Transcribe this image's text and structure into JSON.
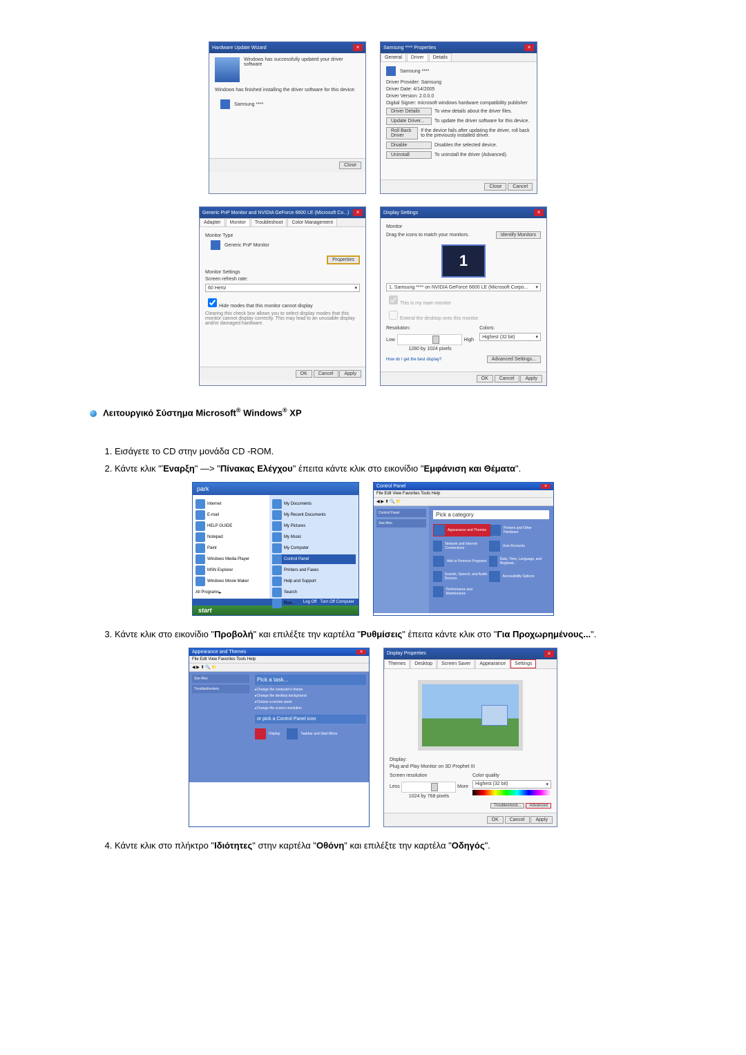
{
  "dialog1": {
    "title": "Hardware Update Wizard",
    "line1": "Windows has successfully updated your driver software",
    "line2": "Windows has finished installing the driver software for this device:",
    "device": "Samsung ****",
    "close_btn": "Close"
  },
  "dialog2": {
    "title": "Samsung **** Properties",
    "tabs": [
      "General",
      "Driver",
      "Details"
    ],
    "device": "Samsung ****",
    "provider_label": "Driver Provider:",
    "provider": "Samsung",
    "date_label": "Driver Date:",
    "date": "4/14/2005",
    "version_label": "Driver Version:",
    "version": "2.0.0.0",
    "signer_label": "Digital Signer:",
    "signer": "microsoft windows hardware compatibility publisher",
    "btn_details": "Driver Details",
    "btn_details_desc": "To view details about the driver files.",
    "btn_update": "Update Driver...",
    "btn_update_desc": "To update the driver software for this device.",
    "btn_rollback": "Roll Back Driver",
    "btn_rollback_desc": "If the device fails after updating the driver, roll back to the previously installed driver.",
    "btn_disable": "Disable",
    "btn_disable_desc": "Disables the selected device.",
    "btn_uninstall": "Uninstall",
    "btn_uninstall_desc": "To uninstall the driver (Advanced).",
    "close": "Close",
    "cancel": "Cancel"
  },
  "dialog3": {
    "title": "Generic PnP Monitor and NVIDIA GeForce 6600 LE (Microsoft Co...)",
    "tabs": [
      "Adapter",
      "Monitor",
      "Troubleshoot",
      "Color Management"
    ],
    "montype_label": "Monitor Type",
    "montype": "Generic PnP Monitor",
    "properties": "Properties",
    "settings_label": "Monitor Settings",
    "refresh_label": "Screen refresh rate:",
    "refresh_value": "60 Hertz",
    "hide_modes": "Hide modes that this monitor cannot display",
    "hide_desc": "Clearing this check box allows you to select display modes that this monitor cannot display correctly. This may lead to an unusable display and/or damaged hardware.",
    "ok": "OK",
    "cancel": "Cancel",
    "apply": "Apply"
  },
  "dialog4": {
    "title": "Display Settings",
    "monitor_label": "Monitor",
    "drag": "Drag the icons to match your monitors.",
    "identify": "Identify Monitors",
    "display_sel": "1. Samsung **** on NVIDIA GeForce 6600 LE (Microsoft Corpo...",
    "primary": "This is my main monitor",
    "extend": "Extend the desktop onto this monitor",
    "resolution": "Resolution:",
    "low": "Low",
    "high": "High",
    "res_value": "1280 by 1024 pixels",
    "colors": "Colors:",
    "color_value": "Highest (32 bit)",
    "best_link": "How do I get the best display?",
    "advanced": "Advanced Settings...",
    "ok": "OK",
    "cancel": "Cancel",
    "apply": "Apply"
  },
  "section_title_pre": "Λειτουργικό Σύστημα Microsoft",
  "section_title_mid": " Windows",
  "section_title_suf": " XP",
  "steps": {
    "s1": "Εισάγετε το CD στην μονάδα CD -ROM.",
    "s2a": "Κάντε κλικ \"",
    "s2b": "Έναρξη",
    "s2c": "\" —> \"",
    "s2d": "Πίνακας Ελέγχου",
    "s2e": "\" έπειτα κάντε κλικ στο εικονίδιο \"",
    "s2f": "Εμφάνιση και Θέματα",
    "s2g": "\".",
    "s3a": "Κάντε κλικ στο εικονίδιο \"",
    "s3b": "Προβολή",
    "s3c": "\" και επιλέξτε την καρτέλα \"",
    "s3d": "Ρυθμίσεις",
    "s3e": "\" έπειτα κάντε κλικ στο \"",
    "s3f": "Για Προχωρημένους...",
    "s3g": "\".",
    "s4a": "Κάντε κλικ στο πλήκτρο \"",
    "s4b": "Ιδιότητες",
    "s4c": "\" στην καρτέλα \"",
    "s4d": "Οθόνη",
    "s4e": "\" και επιλέξτε την καρτέλα \"",
    "s4f": "Οδηγός",
    "s4g": "\"."
  },
  "startmenu": {
    "user": "park",
    "left": [
      "Internet",
      "E-mail",
      "HELP GUIDE",
      "Notepad",
      "Paint",
      "Windows Media Player",
      "MSN Explorer",
      "Windows Movie Maker"
    ],
    "all": "All Programs",
    "right": [
      "My Documents",
      "My Recent Documents",
      "My Pictures",
      "My Music",
      "My Computer",
      "Control Panel",
      "Printers and Faxes",
      "Help and Support",
      "Search",
      "Run..."
    ],
    "logoff": "Log Off",
    "turnoff": "Turn Off Computer",
    "start": "start"
  },
  "cp1": {
    "title": "Control Panel",
    "pick": "Pick a category",
    "tiles": [
      "Appearance and Themes",
      "Printers and Other Hardware",
      "Network and Internet Connections",
      "User Accounts",
      "Add or Remove Programs",
      "Date, Time, Language, and Regional...",
      "Sounds, Speech, and Audio Devices",
      "Accessibility Options",
      "Performance and Maintenance"
    ]
  },
  "ap": {
    "title": "Appearance and Themes",
    "pick": "Pick a task...",
    "t1": "Change the computer's theme",
    "t2": "Change the desktop background",
    "t3": "Choose a screen saver",
    "t4": "Change the screen resolution",
    "orpick": "or pick a Control Panel icon",
    "i1": "Display",
    "i2": "Taskbar and Start Menu"
  },
  "dp": {
    "title": "Display Properties",
    "tabs": [
      "Themes",
      "Desktop",
      "Screen Saver",
      "Appearance",
      "Settings"
    ],
    "display": "Display:",
    "name": "Plug and Play Monitor on 3D Prophet III",
    "res_label": "Screen resolution",
    "less": "Less",
    "more": "More",
    "res": "1024 by 768 pixels",
    "cq_label": "Color quality",
    "cq": "Highest (32 bit)",
    "troubleshoot": "Troubleshoot...",
    "advanced": "Advanced",
    "ok": "OK",
    "cancel": "Cancel",
    "apply": "Apply"
  }
}
